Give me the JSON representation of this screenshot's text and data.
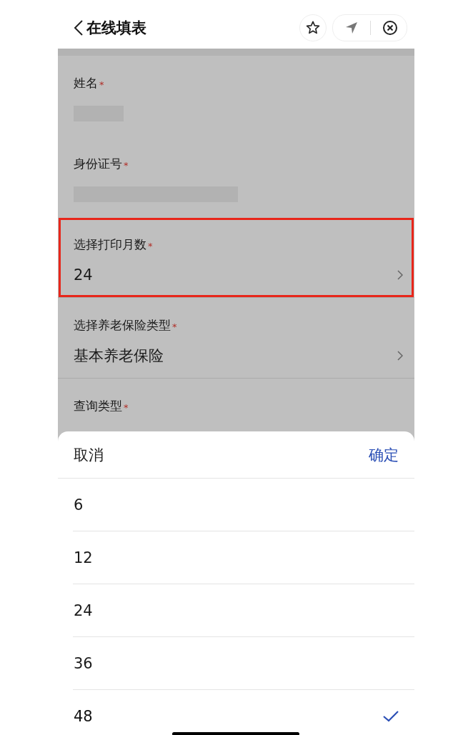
{
  "header": {
    "title": "在线填表"
  },
  "form": {
    "fields": [
      {
        "label": "姓名",
        "mark": "*",
        "kind": "redacted"
      },
      {
        "label": "身份证号",
        "mark": "*",
        "kind": "redacted"
      },
      {
        "label": "选择打印月数",
        "mark": "*",
        "kind": "select",
        "value": "24",
        "highlighted": true
      },
      {
        "label": "选择养老保险类型",
        "mark": "*",
        "kind": "select",
        "value": "基本养老保险",
        "highlighted": false
      },
      {
        "label": "查询类型",
        "mark": "*",
        "kind": "text"
      }
    ]
  },
  "picker": {
    "cancel": "取消",
    "confirm": "确定",
    "options": [
      {
        "label": "6",
        "selected": false
      },
      {
        "label": "12",
        "selected": false
      },
      {
        "label": "24",
        "selected": false
      },
      {
        "label": "36",
        "selected": false
      },
      {
        "label": "48",
        "selected": true
      }
    ]
  }
}
